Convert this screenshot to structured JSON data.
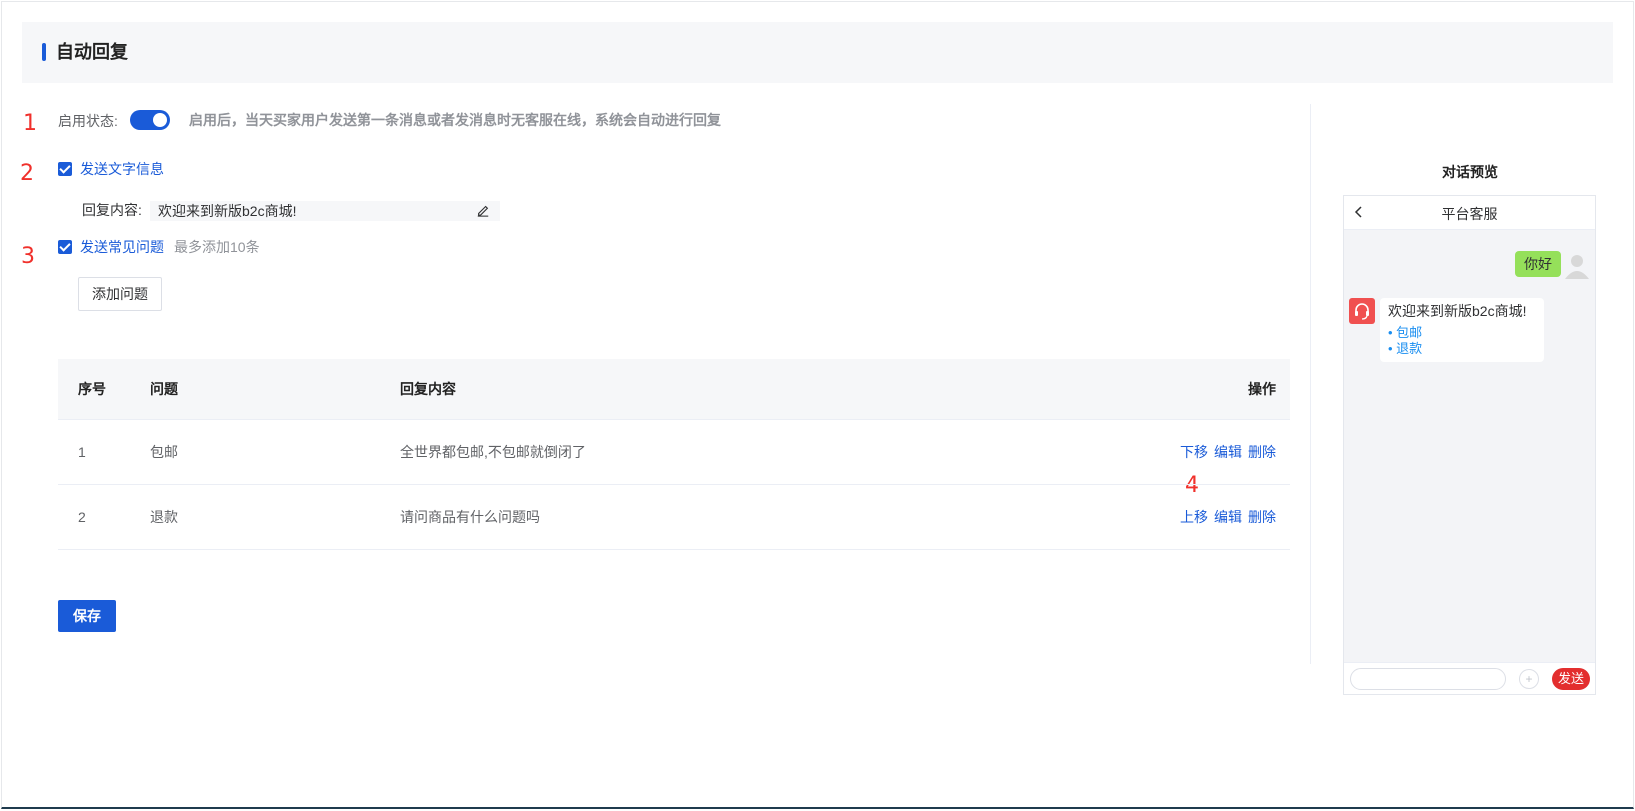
{
  "header": {
    "title": "自动回复"
  },
  "annotations": [
    "1",
    "2",
    "3",
    "4"
  ],
  "status": {
    "label": "启用状态:",
    "enabled": true,
    "description": "启用后，当天买家用户发送第一条消息或者发消息时无客服在线，系统会自动进行回复"
  },
  "text_message": {
    "checkbox_label": "发送文字信息",
    "checked": true,
    "reply_label": "回复内容:",
    "reply_value": "欢迎来到新版b2c商城!"
  },
  "faq": {
    "checkbox_label": "发送常见问题",
    "checked": true,
    "hint": "最多添加10条",
    "add_button": "添加问题"
  },
  "table": {
    "columns": [
      "序号",
      "问题",
      "回复内容",
      "操作"
    ],
    "rows": [
      {
        "index": "1",
        "question": "包邮",
        "answer": "全世界都包邮,不包邮就倒闭了",
        "ops": [
          "下移",
          "编辑",
          "删除"
        ]
      },
      {
        "index": "2",
        "question": "退款",
        "answer": "请问商品有什么问题吗",
        "ops": [
          "上移",
          "编辑",
          "删除"
        ]
      }
    ]
  },
  "save_button": "保存",
  "preview": {
    "title": "对话预览",
    "phone_title": "平台客服",
    "user_message": "你好",
    "reply_message": "欢迎来到新版b2c商城!",
    "faq_items": [
      "• 包邮",
      "• 退款"
    ],
    "plus_label": "+",
    "send_button": "发送"
  },
  "colors": {
    "primary": "#1a5bd8",
    "annotation": "#f0302b",
    "user_bubble": "#95e05a",
    "send": "#e32e2e"
  }
}
